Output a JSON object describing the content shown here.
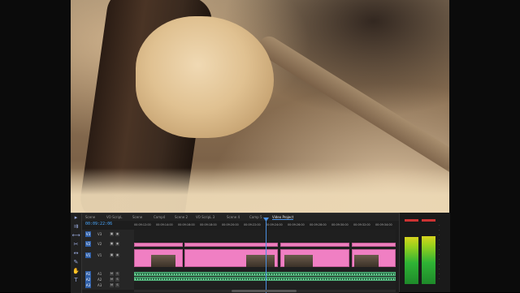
{
  "program_monitor": {
    "subject": "sawdust-on-log-footage"
  },
  "tools": [
    "selection",
    "track-select",
    "ripple",
    "razor",
    "slip",
    "pen",
    "hand",
    "type"
  ],
  "tabs": [
    "Scene",
    "VO ScripL",
    "Scene",
    "Comp4",
    "Scene 2",
    "VO ScripL 3",
    "Scene 4",
    "Comp 5",
    "Video Project"
  ],
  "timecode": "00:09:22:06",
  "ruler": [
    "00:09:12:00",
    "00:09:14:00",
    "00:09:16:00",
    "00:09:18:00",
    "00:09:20:00",
    "00:09:22:00",
    "00:09:24:00",
    "00:09:26:00",
    "00:09:28:00",
    "00:09:30:00",
    "00:09:32:00",
    "00:09:34:00"
  ],
  "tracks": [
    {
      "src": "V3",
      "name": "V3"
    },
    {
      "src": "V2",
      "name": "V2"
    },
    {
      "src": "V1",
      "name": "V1"
    },
    {
      "src": "A1",
      "name": "A1"
    },
    {
      "src": "A2",
      "name": "A2"
    },
    {
      "src": "A3",
      "name": "A3"
    }
  ],
  "colors": {
    "video_clip": "#f07fc3",
    "audio_clip": "#2f7a50",
    "playhead": "#4a90e2",
    "timecode": "#4aa8ff"
  },
  "meters": {
    "left_level": 0.76,
    "right_level": 0.78
  }
}
